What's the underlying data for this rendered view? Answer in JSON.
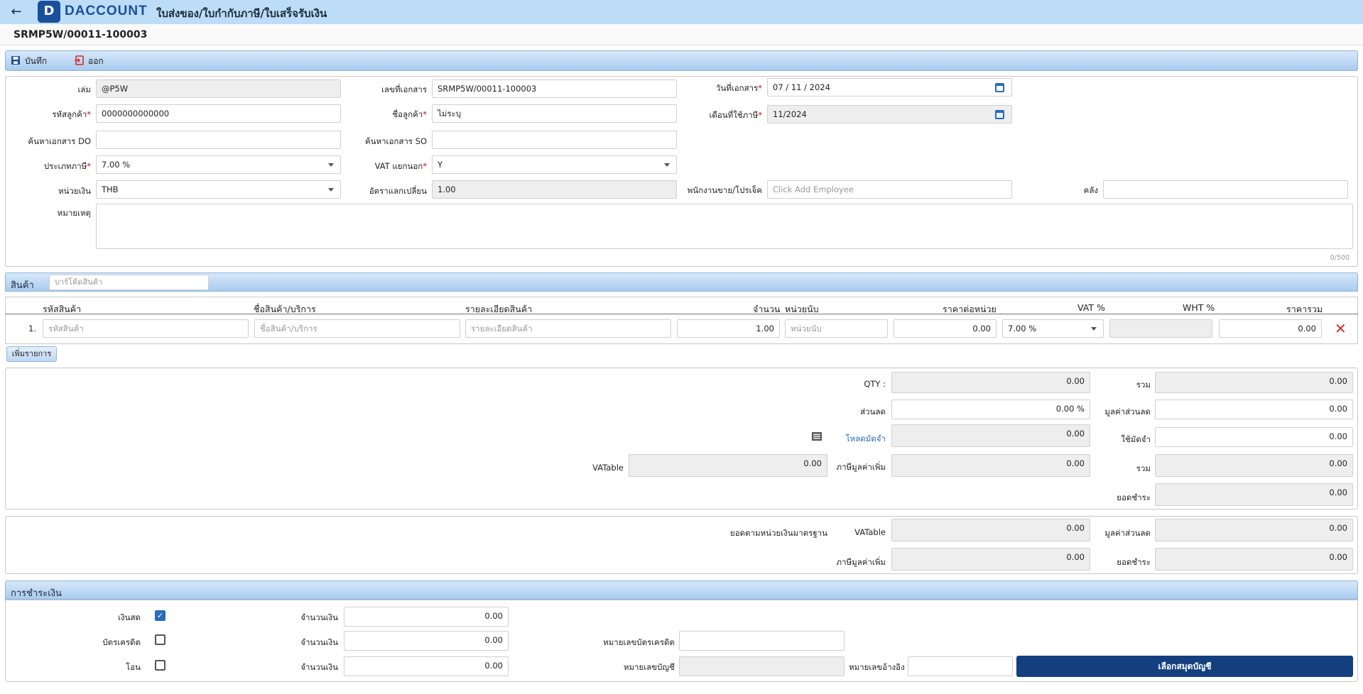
{
  "header": {
    "app_title": "ใบส่งของ/ใบกำกับภาษี/ใบเสร็จรับเงิน",
    "logo_mark": "D",
    "logo_brand_1": "D",
    "logo_brand_2": "ACCOUNT"
  },
  "document": {
    "number": "SRMP5W/00011-100003"
  },
  "toolbar": {
    "save_label": "บันทึก",
    "exit_label": "ออก"
  },
  "form": {
    "book_label": "เล่ม",
    "book_value": "@P5W",
    "docno_label": "เลขที่เอกสาร",
    "docno_value": "SRMP5W/00011-100003",
    "docdate_label": "วันที่เอกสาร",
    "docdate_value": "07 / 11 /  2024",
    "custcode_label": "รหัสลูกค้า",
    "custcode_value": "0000000000000",
    "custname_label": "ชื่อลูกค้า",
    "custname_value": "ไม่ระบุ",
    "taxmonth_label": "เดือนที่ใช้ภาษี",
    "taxmonth_value": "11/2024",
    "search_do_label": "ค้นหาเอกสาร DO",
    "search_do_value": "",
    "search_so_label": "ค้นหาเอกสาร SO",
    "search_so_value": "",
    "taxtype_label": "ประเภทภาษี",
    "taxtype_value": "7.00 %",
    "vat_label": "VAT แยกนอก",
    "vat_value": "Y",
    "currency_label": "หน่วยเงิน",
    "currency_value": "THB",
    "rate_label": "อัตราแลกเปลี่ยน",
    "rate_value": "1.00",
    "employee_label": "พนักงานขาย/โปรเจ็ค",
    "employee_placeholder": "Click Add Employee",
    "warehouse_label": "คลัง",
    "warehouse_value": "",
    "note_label": "หมายเหตุ",
    "note_value": "",
    "note_counter": "0/500"
  },
  "products": {
    "section_title": "สินค้า",
    "barcode_placeholder": "บาร์โค้ดสินค้า",
    "columns": [
      "รหัสสินค้า",
      "ชื่อสินค้า/บริการ",
      "รายละเอียดสินค้า",
      "จำนวน",
      "หน่วยนับ",
      "ราคาต่อหน่วย",
      "VAT %",
      "WHT %",
      "ราคารวม"
    ],
    "rows": [
      {
        "no": "1.",
        "code_ph": "รหัสสินค้า",
        "name_ph": "ชื่อสินค้า/บริการ",
        "detail_ph": "รายละเอียดสินค้า",
        "qty": "1.00",
        "unit_ph": "หน่วยนับ",
        "price": "0.00",
        "vat": "7.00 %",
        "wht": "",
        "total": "0.00"
      }
    ],
    "add_row_label": "เพิ่มรายการ",
    "delete_icon": "close-icon"
  },
  "summary": {
    "qty_label": "QTY :",
    "qty_value": "0.00",
    "sum_label": "รวม",
    "sum_value": "0.00",
    "discount_label": "ส่วนลด",
    "discount_value": "0.00 %",
    "discount_amt_label": "มูลค่าส่วนลด",
    "discount_amt_value": "0.00",
    "load_deposit_label": "โหลดมัดจำ",
    "load_deposit_value": "0.00",
    "use_deposit_label": "ใช้มัดจำ",
    "use_deposit_value": "0.00",
    "vatable_label": "VATable",
    "vatable_value": "0.00",
    "vat_add_label": "ภาษีมูลค่าเพิ่ม",
    "vat_add_value": "0.00",
    "total2_label": "รวม",
    "total2_value": "0.00",
    "pay_label": "ยอดชำระ",
    "pay_value": "0.00"
  },
  "standard": {
    "title": "ยอดตามหน่วยเงินมาตรฐาน",
    "vatable_label": "VATable",
    "vatable_value": "0.00",
    "discount_label": "มูลค่าส่วนลด",
    "discount_value": "0.00",
    "vat_label": "ภาษีมูลค่าเพิ่ม",
    "vat_value": "0.00",
    "pay_label": "ยอดชำระ",
    "pay_value": "0.00"
  },
  "payment": {
    "section_title": "การชำระเงิน",
    "cash_label": "เงินสด",
    "cash_checked": true,
    "card_label": "บัตรเครดิต",
    "card_checked": false,
    "transfer_label": "โอน",
    "transfer_checked": false,
    "amount_label": "จำนวนเงิน",
    "cash_amount": "0.00",
    "card_amount": "0.00",
    "transfer_amount": "0.00",
    "card_no_label": "หมายเลขบัตรเครดิต",
    "card_no_value": "",
    "account_no_label": "หมายเลขบัญชี",
    "account_no_value": "",
    "ref_no_label": "หมายเลขอ้างอิง",
    "ref_no_value": "",
    "choose_account_label": "เลือกสมุดบัญชี"
  },
  "colors": {
    "accent": "#143f7e",
    "header_bg": "#bcdcf7",
    "required": "#d0021b",
    "delete": "#d62a2a"
  }
}
